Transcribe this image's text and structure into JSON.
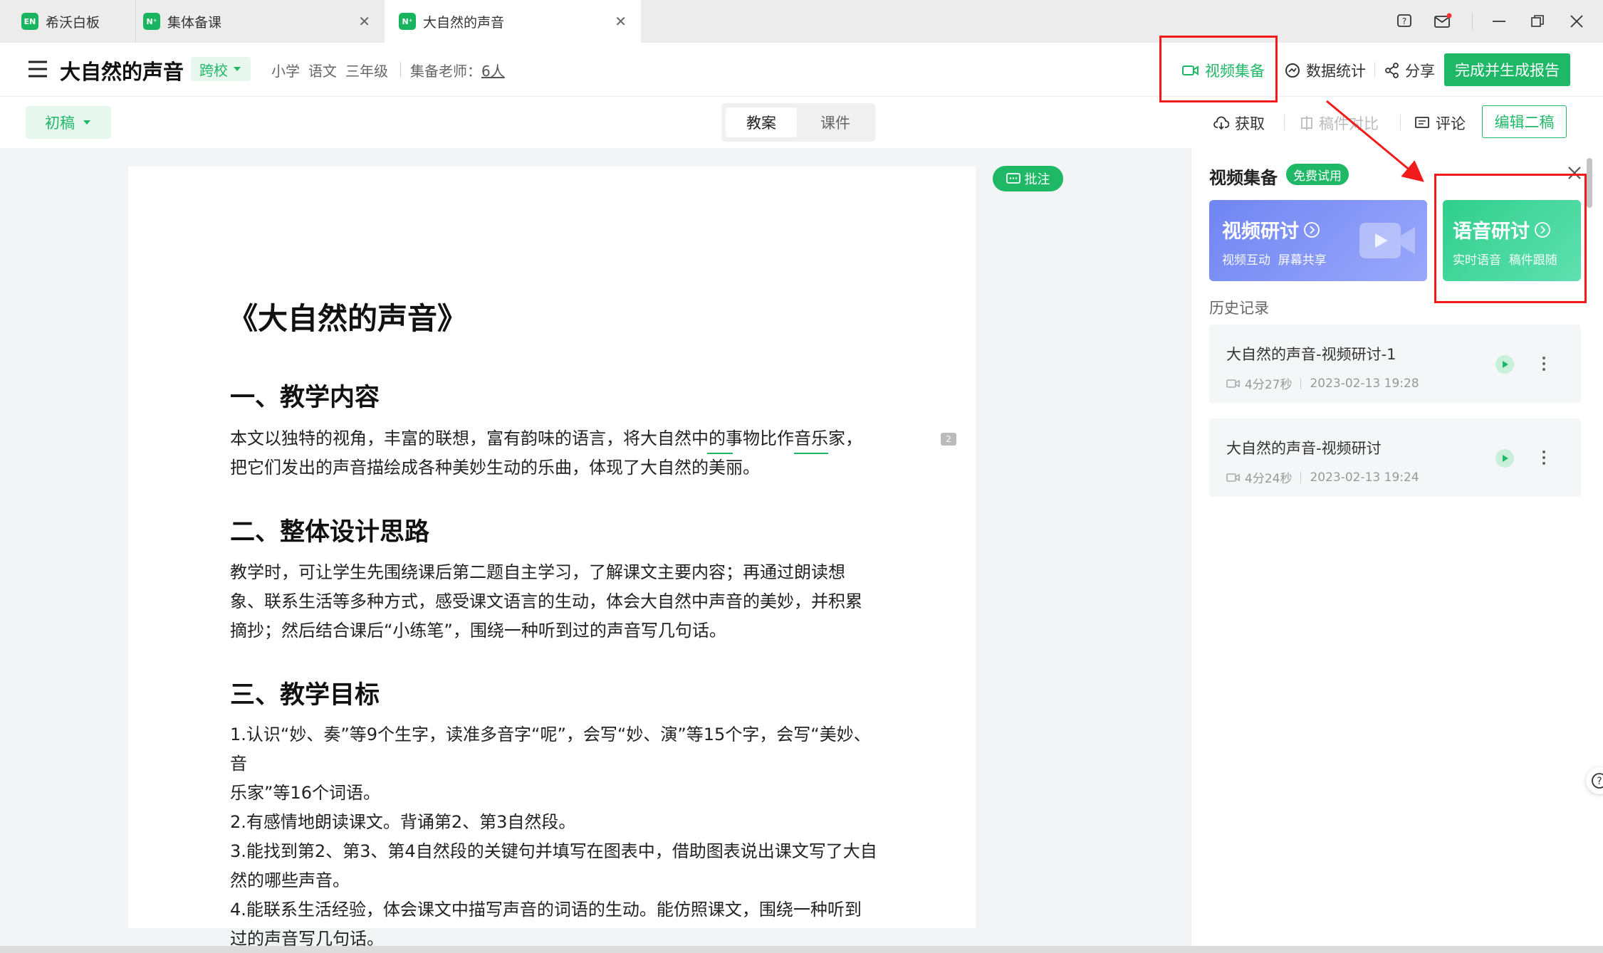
{
  "tabs": [
    {
      "label": "希沃白板",
      "logo": "EN"
    },
    {
      "label": "集体备课",
      "logo": "N⁺"
    },
    {
      "label": "大自然的声音",
      "logo": "N⁺"
    }
  ],
  "header": {
    "title": "大自然的声音",
    "cross_school": "跨校",
    "meta": [
      "小学",
      "语文",
      "三年级"
    ],
    "teachers_label": "集备老师：",
    "teachers_count": "6人",
    "video_prep": "视频集备",
    "data_stats": "数据统计",
    "share": "分享",
    "finish": "完成并生成报告"
  },
  "toolbar": {
    "draft": "初稿",
    "tabs": [
      "教案",
      "课件"
    ],
    "fetch": "获取",
    "compare": "稿件对比",
    "comment": "评论",
    "edit_second": "编辑二稿",
    "annotate": "批注"
  },
  "doc": {
    "title": "《大自然的声音》",
    "sections": [
      {
        "heading": "一、教学内容",
        "body": "本文以独特的视角，丰富的联想，富有韵味的语言，将大自然中的事物比作音乐家，\n把它们发出的声音描绘成各种美妙生动的乐曲，体现了大自然的美丽。"
      },
      {
        "heading": "二、整体设计思路",
        "body": "教学时，可让学生先围绕课后第二题自主学习，了解课文主要内容；再通过朗读想\n象、联系生活等多种方式，感受课文语言的生动，体会大自然中声音的美妙，并积累\n摘抄；然后结合课后“小练笔”，围绕一种听到过的声音写几句话。"
      },
      {
        "heading": "三、教学目标",
        "body": "1.认识“妙、奏”等9个生字，读准多音字“呢”，会写“妙、演”等15个字，会写“美妙、音\n乐家”等16个词语。\n2.有感情地朗读课文。背诵第2、第3自然段。\n3.能找到第2、第3、第4自然段的关键句并填写在图表中，借助图表说出课文写了大自\n然的哪些声音。\n4.能联系生活经验，体会课文中描写声音的词语的生动。能仿照课文，围绕一种听到\n过的声音写几句话。"
      }
    ],
    "comment_count": "2"
  },
  "panel": {
    "title": "视频集备",
    "trial_badge": "免费试用",
    "cards": [
      {
        "title": "视频研讨",
        "sub": "视频互动  屏幕共享",
        "color": "#7c8df5"
      },
      {
        "title": "语音研讨",
        "sub": "实时语音  稿件跟随",
        "color": "#3fd19a"
      }
    ],
    "history_label": "历史记录",
    "history": [
      {
        "title": "大自然的声音-视频研讨-1",
        "duration": "4分27秒",
        "time": "2023-02-13 19:28"
      },
      {
        "title": "大自然的声音-视频研讨",
        "duration": "4分24秒",
        "time": "2023-02-13 19:24"
      }
    ]
  },
  "colors": {
    "accent": "#1fb866",
    "annotation_red": "#f21a1a"
  }
}
